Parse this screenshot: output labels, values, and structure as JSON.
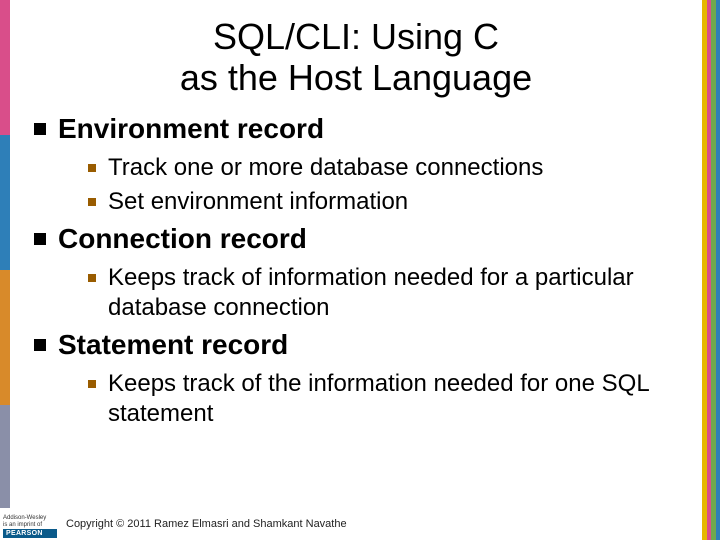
{
  "title_line1": "SQL/CLI: Using C",
  "title_line2": "as the Host Language",
  "sections": [
    {
      "heading": "Environment record",
      "items": [
        "Track one or more database connections",
        "Set environment information"
      ]
    },
    {
      "heading": "Connection record",
      "items": [
        "Keeps track of information needed for a particular database connection"
      ]
    },
    {
      "heading": "Statement record",
      "items": [
        "Keeps track of the information needed for one SQL statement"
      ]
    }
  ],
  "footer": {
    "publisher_top": "Addison-Wesley",
    "publisher_sub": "is an imprint of",
    "publisher_brand": "PEARSON",
    "copyright": "Copyright © 2011 Ramez Elmasri and Shamkant Navathe"
  }
}
